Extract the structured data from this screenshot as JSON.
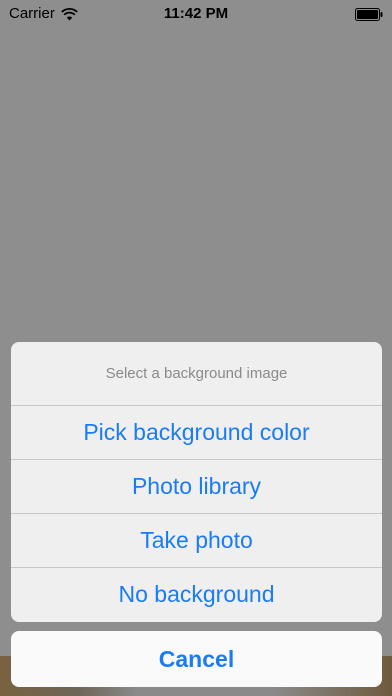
{
  "status_bar": {
    "carrier": "Carrier",
    "time": "11:42 PM",
    "wifi_icon": "wifi-icon",
    "battery_icon": "battery-icon"
  },
  "action_sheet": {
    "title": "Select a background image",
    "options": [
      "Pick background color",
      "Photo library",
      "Take photo",
      "No background"
    ],
    "cancel_label": "Cancel"
  },
  "colors": {
    "accent": "#1a7cf5",
    "overlay": "#8e8e8e",
    "sheet_bg": "#efefef"
  }
}
